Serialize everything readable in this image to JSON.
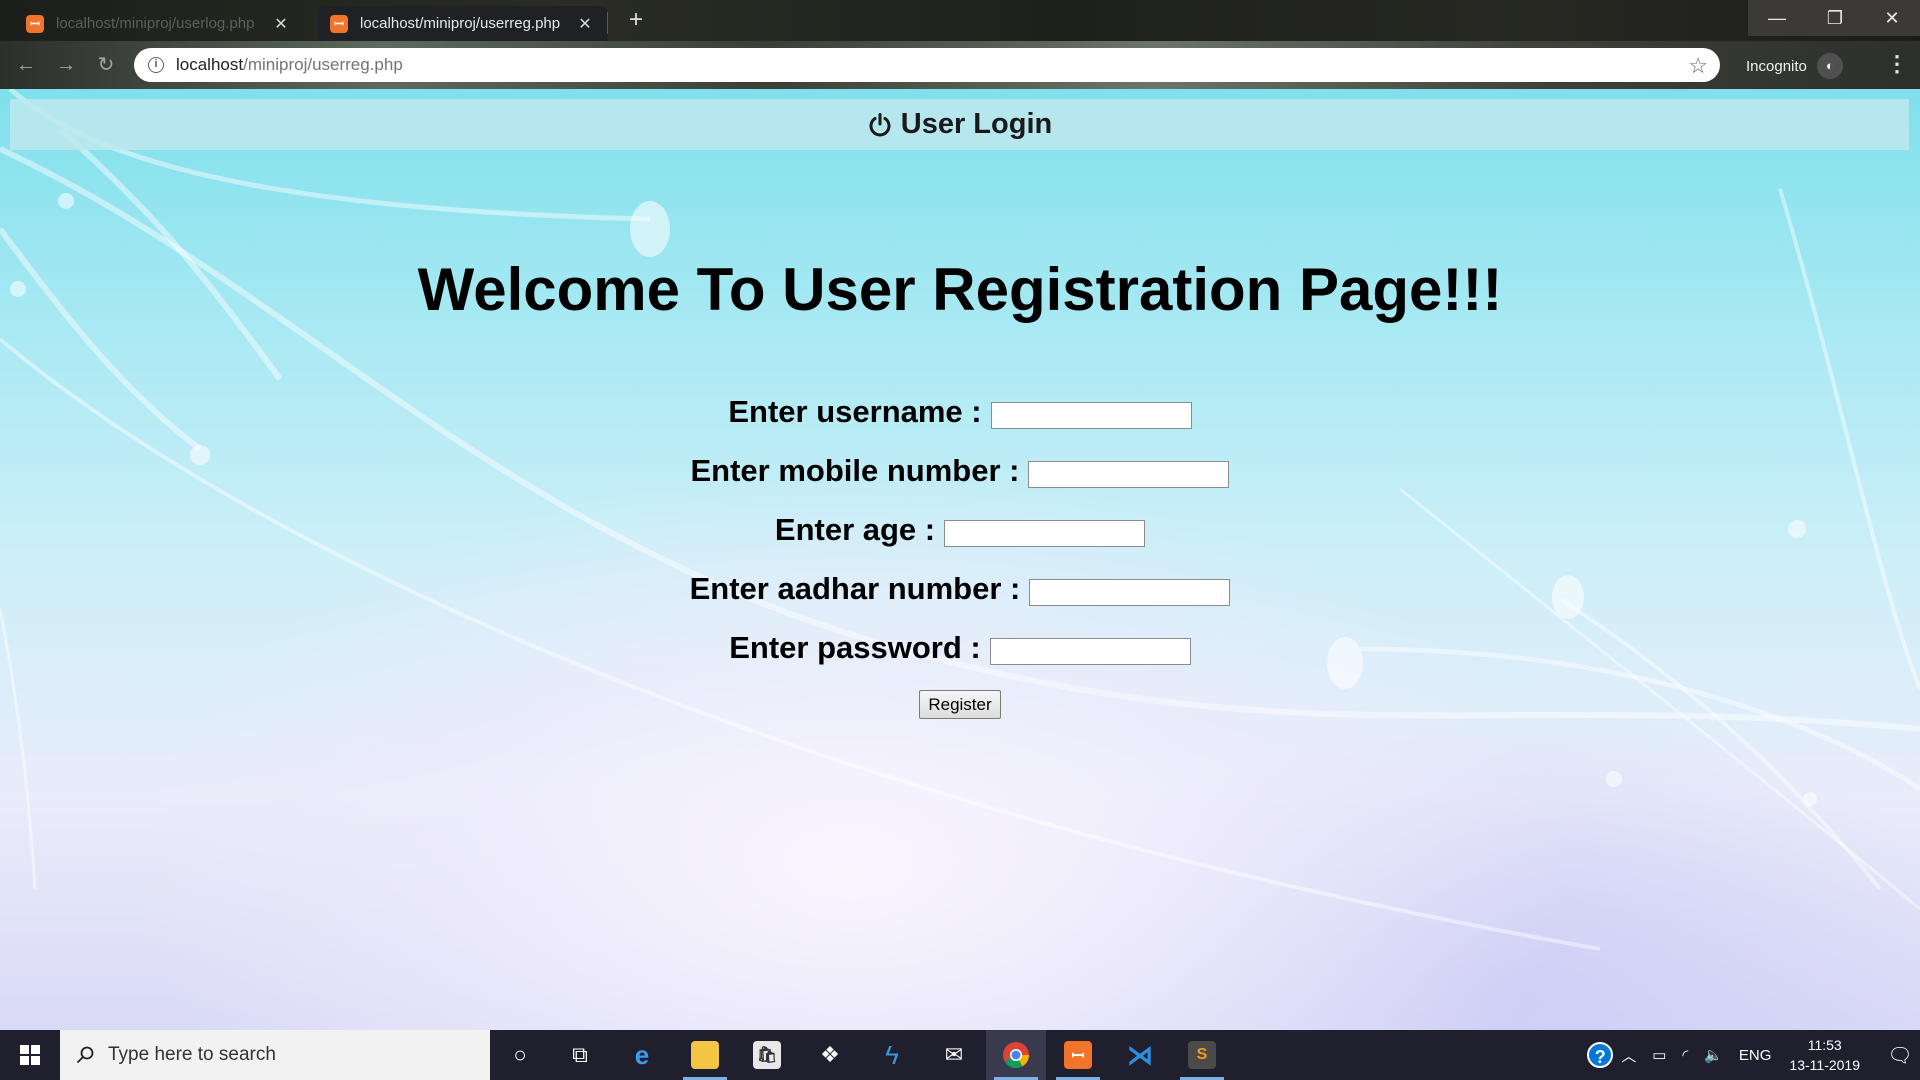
{
  "browser": {
    "tabs": [
      {
        "title": "localhost/miniproj/userlog.php",
        "favicon": "xampp-icon",
        "active": false
      },
      {
        "title": "localhost/miniproj/userreg.php",
        "favicon": "xampp-icon",
        "active": true
      }
    ],
    "new_tab_label": "+",
    "address": {
      "host": "localhost",
      "path": "/miniproj/userreg.php"
    },
    "incognito_label": "Incognito"
  },
  "page": {
    "login_bar_text": "User Login",
    "heading": "Welcome To User Registration Page!!!",
    "form": {
      "fields": [
        {
          "label": "Enter username :",
          "value": ""
        },
        {
          "label": "Enter mobile number :",
          "value": ""
        },
        {
          "label": "Enter age :",
          "value": ""
        },
        {
          "label": "Enter aadhar number :",
          "value": ""
        },
        {
          "label": "Enter password :",
          "value": ""
        }
      ],
      "submit_label": "Register"
    }
  },
  "taskbar": {
    "search_placeholder": "Type here to search",
    "pinned_icons": [
      "cortana-icon",
      "task-view-icon",
      "edge-icon",
      "file-explorer-icon",
      "store-icon",
      "dropbox-icon",
      "vs-code-insiders-icon",
      "mail-icon",
      "chrome-icon",
      "xampp-icon",
      "vs-code-icon",
      "sublime-text-icon"
    ],
    "tray": {
      "language": "ENG",
      "time": "11:53",
      "date": "13-11-2019"
    }
  },
  "colors": {
    "login_bar": "#bee8ee",
    "xampp_orange": "#f2742a",
    "taskbar": "#1f1f2e"
  }
}
